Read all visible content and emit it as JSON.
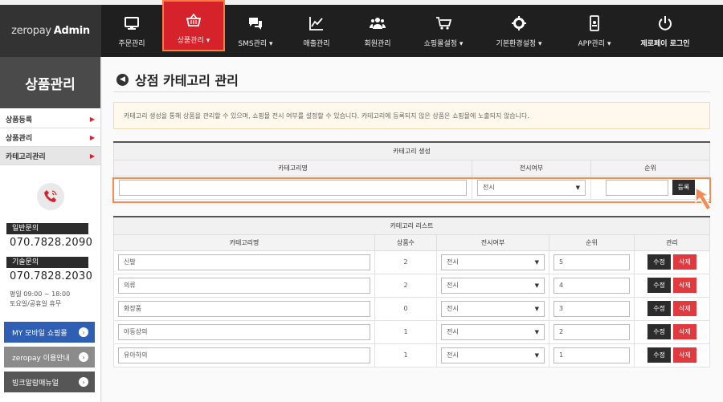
{
  "brand": {
    "part1": "zeropay",
    "part2": "Admin"
  },
  "nav": [
    {
      "label": "주문관리",
      "icon": "monitor-icon"
    },
    {
      "label": "상품관리 ▾",
      "icon": "basket-icon"
    },
    {
      "label": "SMS관리 ▾",
      "icon": "chat-icon"
    },
    {
      "label": "매출관리",
      "icon": "chart-icon"
    },
    {
      "label": "회원관리",
      "icon": "users-icon"
    },
    {
      "label": "쇼핑몰설정 ▾",
      "icon": "cart-icon"
    },
    {
      "label": "기본환경설정 ▾",
      "icon": "gear-icon"
    },
    {
      "label": "APP관리 ▾",
      "icon": "phone-app-icon"
    },
    {
      "label": "제로페이 로그인",
      "icon": "power-icon"
    }
  ],
  "sidebar": {
    "title": "상품관리",
    "items": [
      {
        "label": "상품등록"
      },
      {
        "label": "상품관리"
      },
      {
        "label": "카테고리관리"
      }
    ],
    "general_label": "일반문의",
    "general_phone": "070.7828.2090",
    "tech_label": "기술문의",
    "tech_phone": "070.7828.2030",
    "hours_line1": "평일 09:00 ~ 18:00",
    "hours_line2": "토요일/공휴일 휴무",
    "btn_mobile": "MY 모바일 쇼핑몰",
    "btn_guide": "zeropay 이용안내",
    "btn_manual": "빙크알람매뉴얼"
  },
  "page": {
    "title": "상점 카테고리 관리",
    "notice": "카테고리 생성을 통해 상품을 관리할 수 있으며, 쇼핑몰 전시 여부를 설정할 수 있습니다. 카테고리에 등록되지 않은 상품은 쇼핑몰에 노출되지 않습니다."
  },
  "create": {
    "caption": "카테고리 생성",
    "col_name": "카테고리명",
    "col_display": "전시여부",
    "col_rank": "순위",
    "name_value": "",
    "display_value": "전시",
    "rank_value": "",
    "register_label": "등록"
  },
  "list": {
    "caption": "카테고리 리스트",
    "headers": {
      "name": "카테고리명",
      "count": "상품수",
      "display": "전시여부",
      "rank": "순위",
      "manage": "관리"
    },
    "edit_label": "수정",
    "delete_label": "삭제",
    "rows": [
      {
        "name": "신발",
        "count": "2",
        "display": "전시",
        "rank": "5"
      },
      {
        "name": "의류",
        "count": "2",
        "display": "전시",
        "rank": "4"
      },
      {
        "name": "화장품",
        "count": "0",
        "display": "전시",
        "rank": "3"
      },
      {
        "name": "아동상의",
        "count": "1",
        "display": "전시",
        "rank": "2"
      },
      {
        "name": "유아하의",
        "count": "1",
        "display": "전시",
        "rank": "1"
      }
    ]
  },
  "colors": {
    "accent": "#d5222b",
    "highlight": "#f58a53",
    "topbar": "#1f1f1f"
  }
}
